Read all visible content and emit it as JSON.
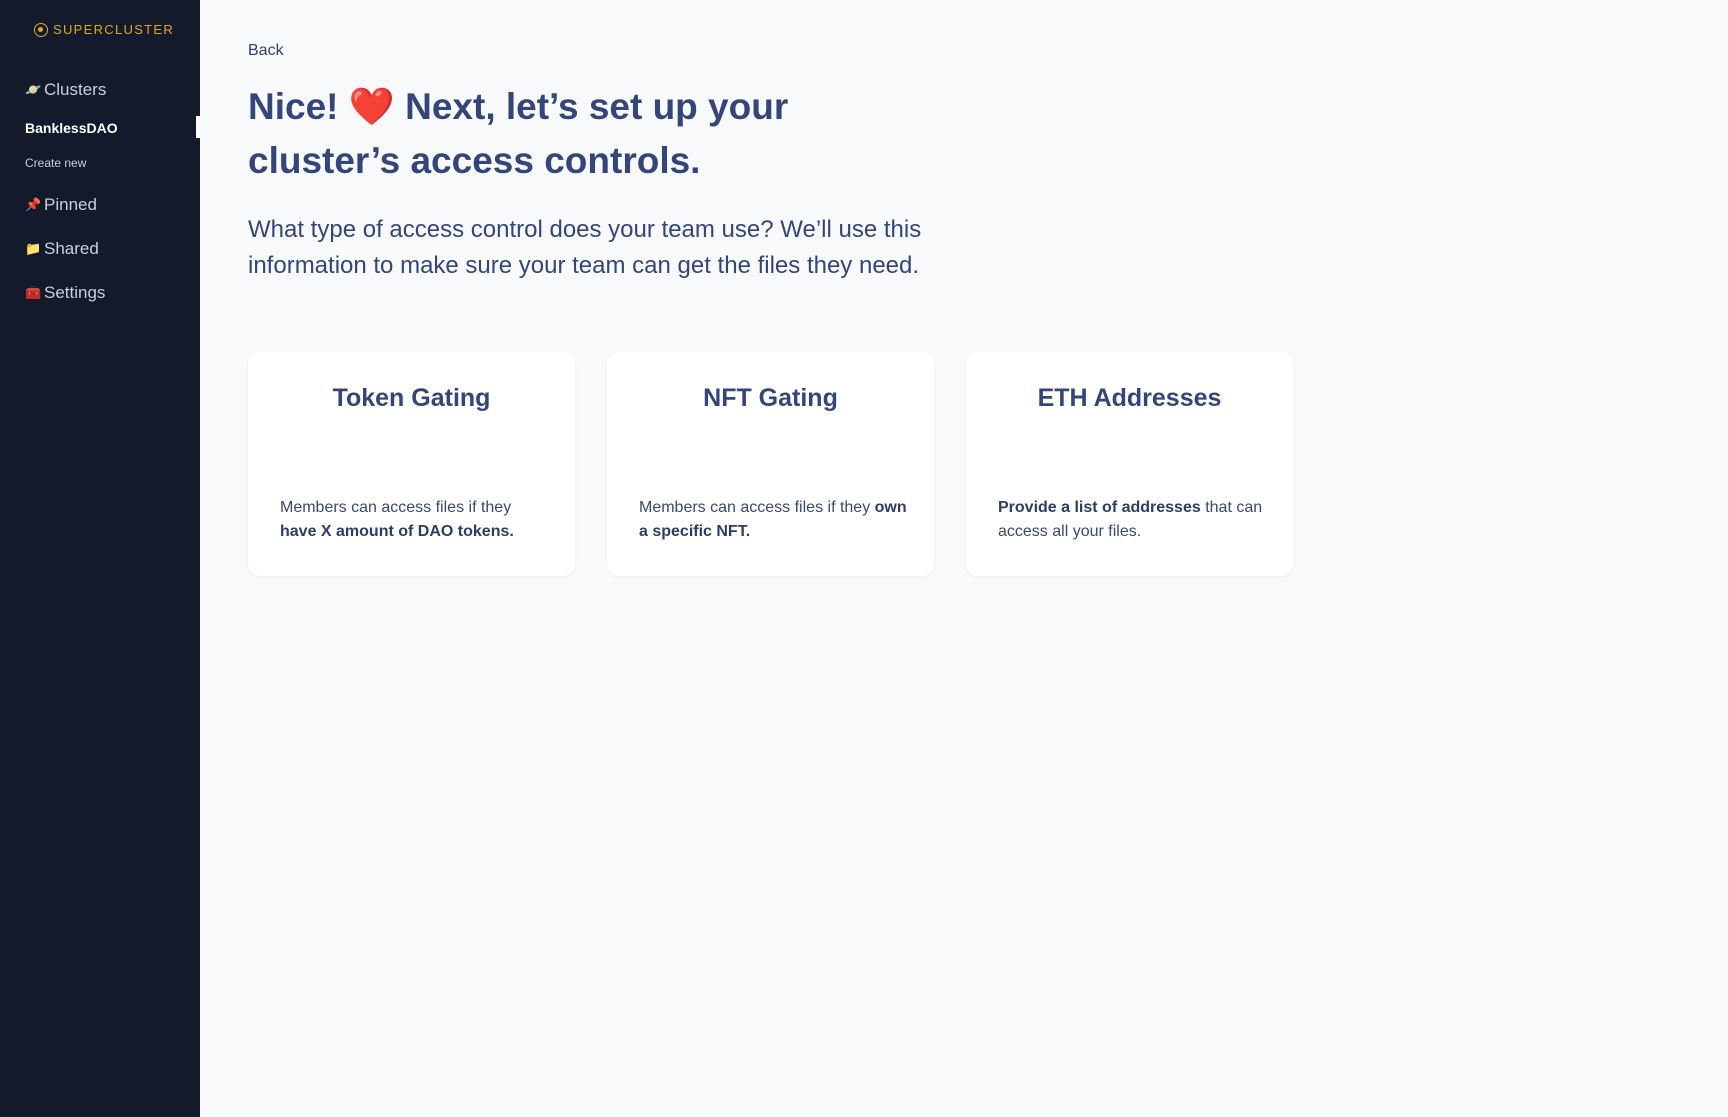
{
  "sidebar": {
    "brand": "SUPERCLUSTER",
    "clusters": {
      "emoji": "🪐",
      "label": "Clusters"
    },
    "active_cluster": "BanklessDAO",
    "create_new": "Create new",
    "pinned": {
      "emoji": "📌",
      "label": "Pinned"
    },
    "shared": {
      "emoji": "📁",
      "label": "Shared"
    },
    "settings": {
      "emoji": "🧰",
      "label": "Settings"
    }
  },
  "main": {
    "back": "Back",
    "title_part1": "Nice! ",
    "title_emoji": "❤️",
    "title_part2": " Next, let’s set up your cluster’s access controls.",
    "subtitle": "What type of access control does your team use? We’ll use this information to make sure your team can get the files they need.",
    "cards": [
      {
        "title": "Token Gating",
        "desc_plain": "Members can access files if they ",
        "desc_bold": "have X amount of DAO tokens."
      },
      {
        "title": "NFT Gating",
        "desc_plain": "Members can access files if they ",
        "desc_bold": "own a specific NFT."
      },
      {
        "title": "ETH Addresses",
        "desc_bold": "Provide a list of addresses",
        "desc_plain": " that can access all your files."
      }
    ]
  },
  "colors": {
    "sidebar_bg": "#121a2b",
    "brand_gold": "#e0a820",
    "heading_navy": "#34457a",
    "page_bg": "#f8f9fb"
  }
}
